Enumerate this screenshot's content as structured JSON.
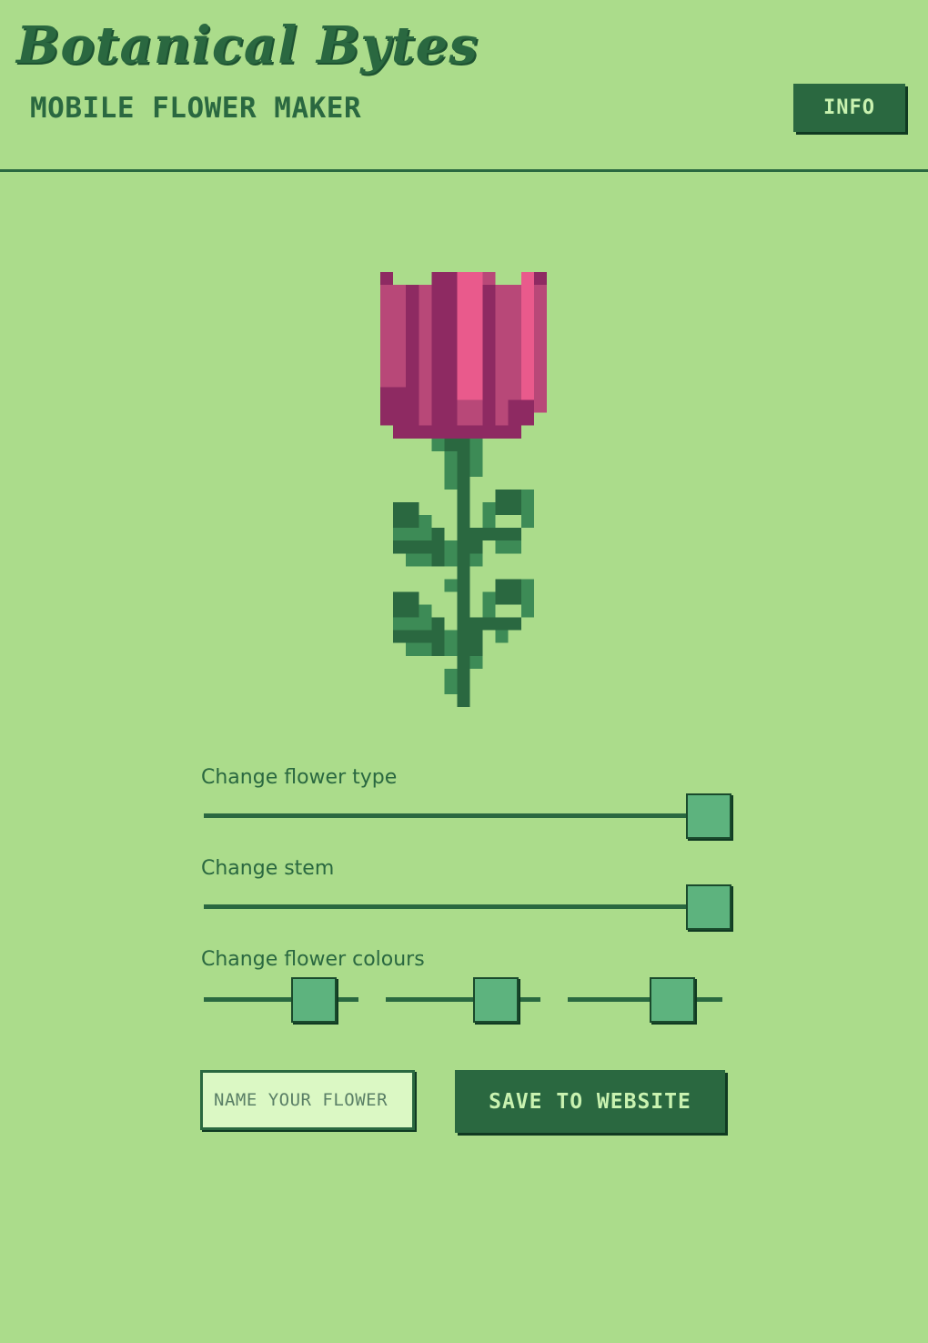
{
  "header": {
    "title": "Botanical Bytes",
    "subtitle": "MOBILE FLOWER MAKER",
    "info_label": "INFO"
  },
  "colors": {
    "background": "#abdc8b",
    "accent_dark": "#2a6840",
    "button_text": "#c9f2b0",
    "slider_thumb": "#5db37e",
    "petal_light": "#e95a8c",
    "petal_mid": "#b84878",
    "petal_dark": "#8e2a62",
    "stem_dark": "#2a6840",
    "stem_light": "#3d8b56"
  },
  "flower": {
    "icon": "pixel-flower-icon"
  },
  "controls": {
    "flower_type": {
      "label": "Change flower type",
      "value": 1.0
    },
    "stem": {
      "label": "Change stem",
      "value": 1.0
    },
    "colours": {
      "label": "Change flower colours",
      "values": [
        0.8,
        0.8,
        0.75
      ]
    }
  },
  "actions": {
    "name_placeholder": "NAME YOUR FLOWER",
    "name_value": "",
    "save_label": "SAVE TO WEBSITE"
  }
}
